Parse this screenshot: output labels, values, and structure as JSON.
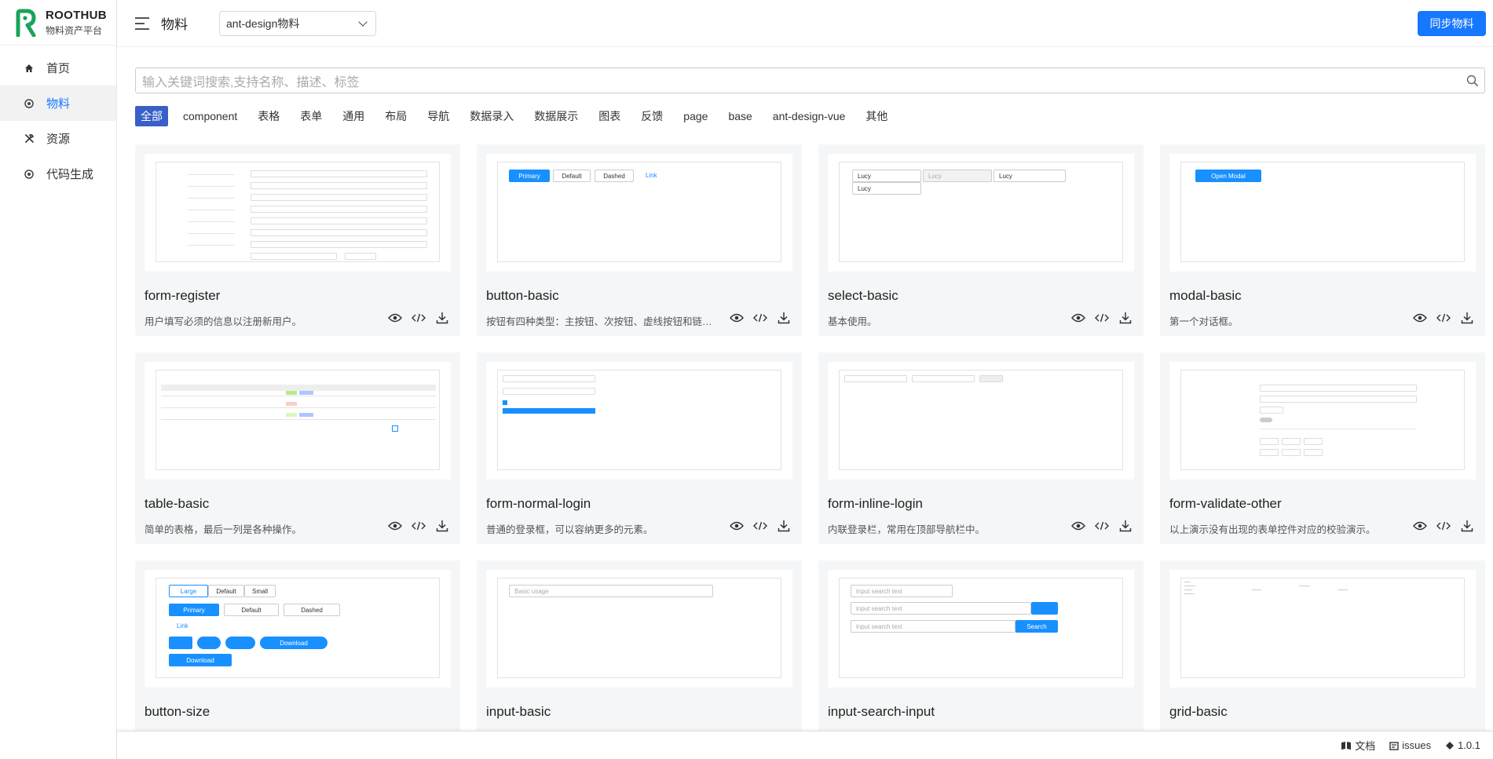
{
  "brand": {
    "name": "ROOTHUB",
    "subtitle": "物料资产平台",
    "color": "#19a35c"
  },
  "sidebar": {
    "items": [
      {
        "label": "首页",
        "icon": "home-icon",
        "active": false
      },
      {
        "label": "物料",
        "icon": "material-icon",
        "active": true
      },
      {
        "label": "资源",
        "icon": "tools-icon",
        "active": false
      },
      {
        "label": "代码生成",
        "icon": "code-gen-icon",
        "active": false
      }
    ]
  },
  "header": {
    "title": "物料",
    "select_value": "ant-design物料",
    "sync_button": "同步物料"
  },
  "search": {
    "placeholder": "输入关键词搜索,支持名称、描述、标签"
  },
  "tags": [
    "全部",
    "component",
    "表格",
    "表单",
    "通用",
    "布局",
    "导航",
    "数据录入",
    "数据展示",
    "图表",
    "反馈",
    "page",
    "base",
    "ant-design-vue",
    "其他"
  ],
  "cards": [
    {
      "title": "form-register",
      "desc": "用户填写必须的信息以注册新用户。"
    },
    {
      "title": "button-basic",
      "desc": "按钮有四种类型：主按钮、次按钮、虚线按钮和链接按钮。"
    },
    {
      "title": "select-basic",
      "desc": "基本使用。"
    },
    {
      "title": "modal-basic",
      "desc": "第一个对话框。"
    },
    {
      "title": "table-basic",
      "desc": "简单的表格，最后一列是各种操作。"
    },
    {
      "title": "form-normal-login",
      "desc": "普通的登录框，可以容纳更多的元素。"
    },
    {
      "title": "form-inline-login",
      "desc": "内联登录栏，常用在顶部导航栏中。"
    },
    {
      "title": "form-validate-other",
      "desc": "以上演示没有出现的表单控件对应的校验演示。"
    },
    {
      "title": "button-size",
      "desc": ""
    },
    {
      "title": "input-basic",
      "desc": ""
    },
    {
      "title": "input-search-input",
      "desc": ""
    },
    {
      "title": "grid-basic",
      "desc": ""
    }
  ],
  "previews": {
    "button_basic": [
      "Primary",
      "Default",
      "Dashed",
      "Link"
    ],
    "select_basic": [
      "Lucy",
      "Lucy",
      "Lucy",
      "Lucy"
    ],
    "modal_basic": "Open Modal",
    "button_size": [
      "Large",
      "Default",
      "Small",
      "Primary",
      "Default",
      "Dashed",
      "Link",
      "Download",
      "Download"
    ],
    "input_basic": "Basic usage",
    "input_search": [
      "input search text",
      "input search text",
      "input search text",
      "Search"
    ]
  },
  "footer": {
    "docs": "文档",
    "issues": "issues",
    "version": "1.0.1"
  },
  "colors": {
    "primary": "#1677ff",
    "tag_active": "#3860c8"
  }
}
